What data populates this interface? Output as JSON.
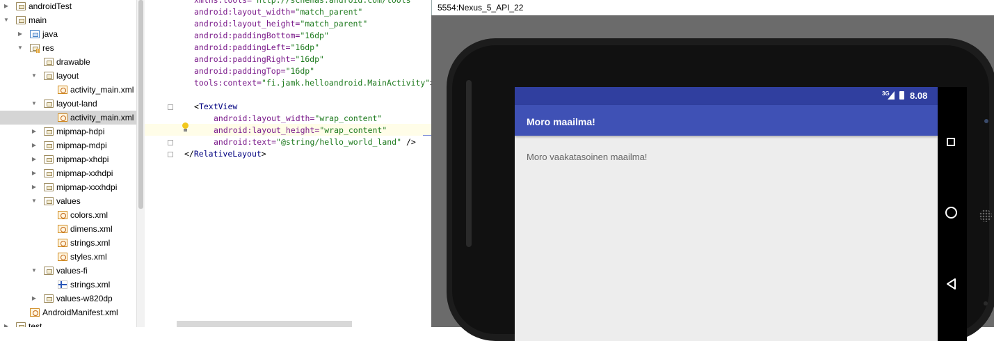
{
  "project_tree": {
    "items": [
      {
        "label": "androidTest",
        "icon": "folder-icon",
        "expanded": false
      },
      {
        "label": "main",
        "icon": "folder-icon",
        "expanded": true
      },
      {
        "label": "java",
        "icon": "folder-blue-icon",
        "expanded": false
      },
      {
        "label": "res",
        "icon": "res-folder-icon",
        "expanded": true
      },
      {
        "label": "drawable",
        "icon": "folder-icon",
        "expanded": null
      },
      {
        "label": "layout",
        "icon": "folder-icon",
        "expanded": true
      },
      {
        "label": "activity_main.xml",
        "icon": "xml-file-icon",
        "expanded": null
      },
      {
        "label": "layout-land",
        "icon": "folder-icon",
        "expanded": true
      },
      {
        "label": "activity_main.xml",
        "icon": "xml-file-icon",
        "expanded": null,
        "selected": true
      },
      {
        "label": "mipmap-hdpi",
        "icon": "folder-icon",
        "expanded": false
      },
      {
        "label": "mipmap-mdpi",
        "icon": "folder-icon",
        "expanded": false
      },
      {
        "label": "mipmap-xhdpi",
        "icon": "folder-icon",
        "expanded": false
      },
      {
        "label": "mipmap-xxhdpi",
        "icon": "folder-icon",
        "expanded": false
      },
      {
        "label": "mipmap-xxxhdpi",
        "icon": "folder-icon",
        "expanded": false
      },
      {
        "label": "values",
        "icon": "folder-icon",
        "expanded": true
      },
      {
        "label": "colors.xml",
        "icon": "xml-file-icon",
        "expanded": null
      },
      {
        "label": "dimens.xml",
        "icon": "xml-file-icon",
        "expanded": null
      },
      {
        "label": "strings.xml",
        "icon": "xml-file-icon",
        "expanded": null
      },
      {
        "label": "styles.xml",
        "icon": "xml-file-icon",
        "expanded": null
      },
      {
        "label": "values-fi",
        "icon": "folder-icon",
        "expanded": true
      },
      {
        "label": "strings.xml",
        "icon": "finnish-flag-icon",
        "expanded": null
      },
      {
        "label": "values-w820dp",
        "icon": "folder-icon",
        "expanded": false
      },
      {
        "label": "AndroidManifest.xml",
        "icon": "manifest-icon",
        "expanded": null
      },
      {
        "label": "test",
        "icon": "folder-icon",
        "expanded": false
      }
    ]
  },
  "editor": {
    "lines": [
      [
        {
          "t": "xmlns:tools=",
          "c": "attr"
        },
        {
          "t": "\"http://schemas.android.com/tools\"",
          "c": "str"
        }
      ],
      [
        {
          "t": "android:layout_width=",
          "c": "attr"
        },
        {
          "t": "\"match_parent\"",
          "c": "str"
        }
      ],
      [
        {
          "t": "android:layout_height=",
          "c": "attr"
        },
        {
          "t": "\"match_parent\"",
          "c": "str"
        }
      ],
      [
        {
          "t": "android:paddingBottom=",
          "c": "attr"
        },
        {
          "t": "\"16dp\"",
          "c": "str"
        }
      ],
      [
        {
          "t": "android:paddingLeft=",
          "c": "attr"
        },
        {
          "t": "\"16dp\"",
          "c": "str"
        }
      ],
      [
        {
          "t": "android:paddingRight=",
          "c": "attr"
        },
        {
          "t": "\"16dp\"",
          "c": "str"
        }
      ],
      [
        {
          "t": "android:paddingTop=",
          "c": "attr"
        },
        {
          "t": "\"16dp\"",
          "c": "str"
        }
      ],
      [
        {
          "t": "tools:context=",
          "c": "attr"
        },
        {
          "t": "\"fi.jamk.helloandroid.MainActivity\"",
          "c": "str"
        },
        {
          "t": ">",
          "c": "plain"
        }
      ],
      [],
      [
        {
          "t": "<",
          "c": "plain"
        },
        {
          "t": "TextView",
          "c": "tag"
        }
      ],
      [
        {
          "t": "android:layout_width=",
          "c": "attr"
        },
        {
          "t": "\"wrap_content\"",
          "c": "str"
        }
      ],
      [
        {
          "t": "android:layout_height=",
          "c": "attr"
        },
        {
          "t": "\"wrap_content\"",
          "c": "str"
        }
      ],
      [
        {
          "t": "android:text=",
          "c": "attr"
        },
        {
          "t": "\"@string/hello_world_land\"",
          "c": "str"
        },
        {
          "t": " />",
          "c": "plain"
        }
      ],
      [
        {
          "t": "</",
          "c": "plain"
        },
        {
          "t": "RelativeLayout",
          "c": "tag"
        },
        {
          "t": ">",
          "c": "plain"
        }
      ]
    ]
  },
  "emulator": {
    "window_title": "5554:Nexus_5_API_22",
    "status_network": "3G",
    "status_time": "8.08",
    "app_title": "Moro maailma!",
    "app_text": "Moro vaakatasoinen maailma!",
    "colors": {
      "status_bar": "#303f9f",
      "app_bar": "#3f51b5",
      "screen_bg": "#ededed"
    }
  }
}
